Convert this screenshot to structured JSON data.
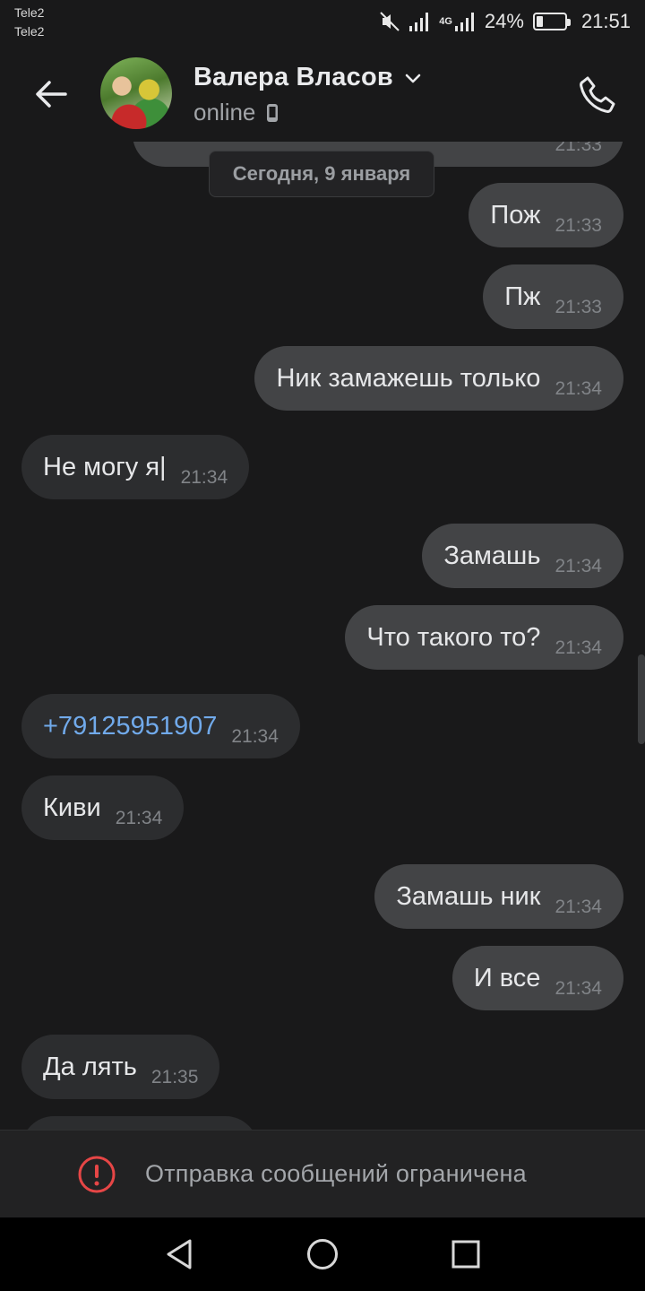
{
  "status_bar": {
    "carrier_1": "Tele2",
    "carrier_2": "Tele2",
    "network": "4G",
    "battery": "24%",
    "battery_level": 0.24,
    "time": "21:51"
  },
  "header": {
    "contact_name": "Валера Власов",
    "status": "online",
    "icons": {
      "back": "arrow-left-icon",
      "dropdown": "chevron-down-icon",
      "device": "mobile-device-icon",
      "call": "phone-icon"
    }
  },
  "chat": {
    "date_separator": "Сегодня, 9 января",
    "top_partial_time": "21:33",
    "messages": [
      {
        "dir": "out",
        "text": "Пож",
        "time": "21:33"
      },
      {
        "dir": "out",
        "text": "Пж",
        "time": "21:33"
      },
      {
        "dir": "out",
        "text": "Ник замажешь только",
        "time": "21:34"
      },
      {
        "dir": "in",
        "text": "Не могу я|",
        "time": "21:34"
      },
      {
        "dir": "out",
        "text": "Замашь",
        "time": "21:34"
      },
      {
        "dir": "out",
        "text": "Что такого то?",
        "time": "21:34"
      },
      {
        "dir": "in",
        "text": "+79125951907",
        "time": "21:34",
        "link": true
      },
      {
        "dir": "in",
        "text": "Киви",
        "time": "21:34"
      },
      {
        "dir": "out",
        "text": "Замашь ник",
        "time": "21:34"
      },
      {
        "dir": "out",
        "text": "И все",
        "time": "21:34"
      },
      {
        "dir": "in",
        "text": "Да лять",
        "time": "21:35"
      }
    ]
  },
  "restriction": {
    "text": "Отправка сообщений ограничена",
    "icon": "alert-circle-icon",
    "icon_color": "#e64646"
  },
  "nav": {
    "back": "triangle-back-icon",
    "home": "circle-home-icon",
    "recents": "square-recents-icon"
  },
  "colors": {
    "background": "#19191a",
    "outgoing_bubble": "#434446",
    "incoming_bubble": "#2c2d2f",
    "link": "#71aaeb"
  }
}
